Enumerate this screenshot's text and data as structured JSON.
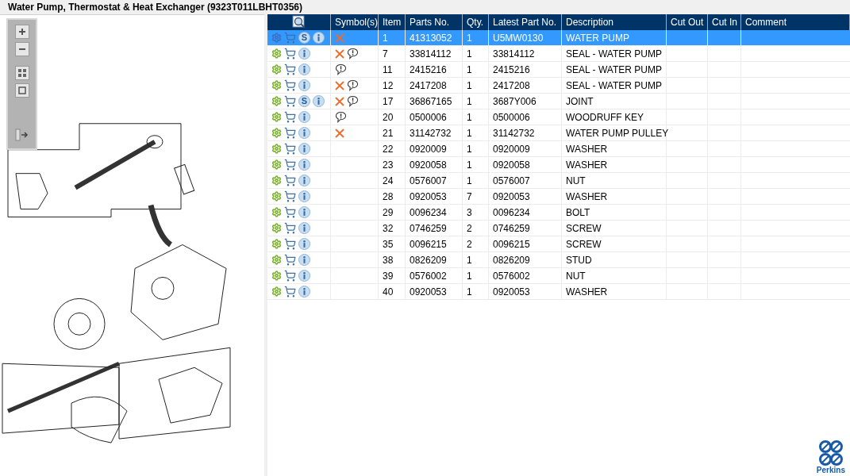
{
  "title": "Water Pump, Thermostat & Heat Exchanger (9323T011LBHT0356)",
  "diagram": {
    "kind": "picture"
  },
  "table": {
    "columns": [
      "Symbol(s)",
      "Item",
      "Parts No.",
      "Qty.",
      "Latest Part No.",
      "Description",
      "Cut Out",
      "Cut In",
      "Comment"
    ],
    "rows": [
      {
        "selected": true,
        "badge": "S",
        "removed": true,
        "note": false,
        "item": "1",
        "part_no": "41313052",
        "qty": "1",
        "latest": "U5MW0130",
        "description": "WATER PUMP"
      },
      {
        "selected": false,
        "removed": true,
        "note": true,
        "item": "7",
        "part_no": "33814112",
        "qty": "1",
        "latest": "33814112",
        "description": "SEAL - WATER PUMP"
      },
      {
        "selected": false,
        "removed": false,
        "note": true,
        "item": "11",
        "part_no": "2415216",
        "qty": "1",
        "latest": "2415216",
        "description": "SEAL - WATER PUMP"
      },
      {
        "selected": false,
        "removed": true,
        "note": true,
        "item": "12",
        "part_no": "2417208",
        "qty": "1",
        "latest": "2417208",
        "description": "SEAL - WATER PUMP"
      },
      {
        "selected": false,
        "badge": "S",
        "removed": true,
        "note": true,
        "item": "17",
        "part_no": "36867165",
        "qty": "1",
        "latest": "3687Y006",
        "description": "JOINT"
      },
      {
        "selected": false,
        "removed": false,
        "note": true,
        "item": "20",
        "part_no": "0500006",
        "qty": "1",
        "latest": "0500006",
        "description": "WOODRUFF KEY"
      },
      {
        "selected": false,
        "removed": true,
        "note": false,
        "item": "21",
        "part_no": "31142732",
        "qty": "1",
        "latest": "31142732",
        "description": "WATER PUMP PULLEY"
      },
      {
        "selected": false,
        "removed": false,
        "note": false,
        "item": "22",
        "part_no": "0920009",
        "qty": "1",
        "latest": "0920009",
        "description": "WASHER"
      },
      {
        "selected": false,
        "removed": false,
        "note": false,
        "item": "23",
        "part_no": "0920058",
        "qty": "1",
        "latest": "0920058",
        "description": "WASHER"
      },
      {
        "selected": false,
        "removed": false,
        "note": false,
        "item": "24",
        "part_no": "0576007",
        "qty": "1",
        "latest": "0576007",
        "description": "NUT"
      },
      {
        "selected": false,
        "removed": false,
        "note": false,
        "item": "28",
        "part_no": "0920053",
        "qty": "7",
        "latest": "0920053",
        "description": "WASHER"
      },
      {
        "selected": false,
        "removed": false,
        "note": false,
        "item": "29",
        "part_no": "0096234",
        "qty": "3",
        "latest": "0096234",
        "description": "BOLT"
      },
      {
        "selected": false,
        "removed": false,
        "note": false,
        "item": "32",
        "part_no": "0746259",
        "qty": "2",
        "latest": "0746259",
        "description": "SCREW"
      },
      {
        "selected": false,
        "removed": false,
        "note": false,
        "item": "35",
        "part_no": "0096215",
        "qty": "2",
        "latest": "0096215",
        "description": "SCREW"
      },
      {
        "selected": false,
        "removed": false,
        "note": false,
        "item": "38",
        "part_no": "0826209",
        "qty": "1",
        "latest": "0826209",
        "description": "STUD"
      },
      {
        "selected": false,
        "removed": false,
        "note": false,
        "item": "39",
        "part_no": "0576002",
        "qty": "1",
        "latest": "0576002",
        "description": "NUT"
      },
      {
        "selected": false,
        "removed": false,
        "note": false,
        "item": "40",
        "part_no": "0920053",
        "qty": "1",
        "latest": "0920053",
        "description": "WASHER"
      }
    ]
  },
  "brand": {
    "name": "Perkins"
  }
}
